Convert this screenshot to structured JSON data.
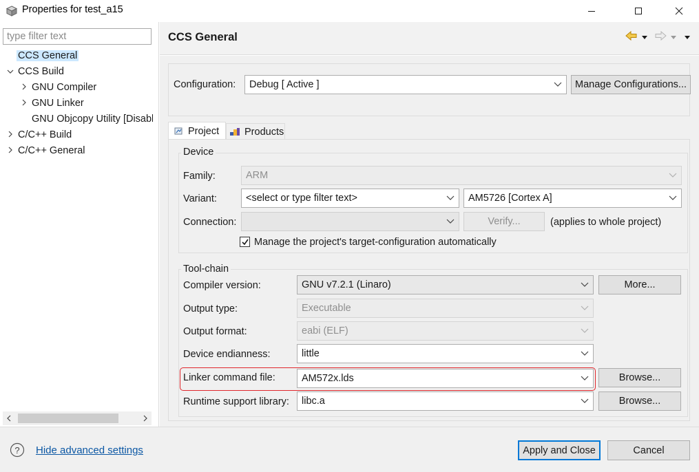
{
  "window": {
    "title": "Properties for test_a15"
  },
  "left": {
    "filter_placeholder": "type filter text",
    "tree": [
      {
        "label": "CCS General",
        "level": 0,
        "expander": "",
        "selected": true
      },
      {
        "label": "CCS Build",
        "level": 0,
        "expander": "expanded"
      },
      {
        "label": "GNU Compiler",
        "level": 1,
        "expander": "collapsed"
      },
      {
        "label": "GNU Linker",
        "level": 1,
        "expander": "collapsed"
      },
      {
        "label": "GNU Objcopy Utility  [Disabled]",
        "level": 1,
        "expander": ""
      },
      {
        "label": "C/C++ Build",
        "level": 0,
        "expander": "collapsed"
      },
      {
        "label": "C/C++ General",
        "level": 0,
        "expander": "collapsed"
      }
    ]
  },
  "page": {
    "title": "CCS General",
    "configuration": {
      "label": "Configuration:",
      "value": "Debug  [ Active ]",
      "manage_button": "Manage Configurations..."
    },
    "tabs": [
      {
        "label": "Project",
        "active": true,
        "icon": "project-icon"
      },
      {
        "label": "Products",
        "active": false,
        "icon": "products-icon"
      }
    ],
    "device": {
      "group_title": "Device",
      "family_label": "Family:",
      "family_value": "ARM",
      "variant_label": "Variant:",
      "variant_filter": "<select or type filter text>",
      "variant_value": "AM5726 [Cortex A]",
      "connection_label": "Connection:",
      "connection_value": "",
      "verify_button": "Verify...",
      "applies_note": "(applies to whole project)",
      "manage_checkbox_label": "Manage the project's target-configuration automatically",
      "manage_checked": true
    },
    "toolchain": {
      "group_title": "Tool-chain",
      "compiler_label": "Compiler version:",
      "compiler_value": "GNU v7.2.1 (Linaro)",
      "more_button": "More...",
      "output_type_label": "Output type:",
      "output_type_value": "Executable",
      "output_format_label": "Output format:",
      "output_format_value": "eabi (ELF)",
      "endianness_label": "Device endianness:",
      "endianness_value": "little",
      "linker_label": "Linker command file:",
      "linker_value": "AM572x.lds",
      "browse_button": "Browse...",
      "runtime_label": "Runtime support library:",
      "runtime_value": "libc.a",
      "browse_button_2": "Browse..."
    }
  },
  "footer": {
    "advanced_link": "Hide advanced settings",
    "apply_close": "Apply and Close",
    "cancel": "Cancel"
  },
  "colors": {
    "highlight_border": "#e0262b",
    "selection": "#cce8ff",
    "link": "#0b57a4",
    "default_button_border": "#0078d7"
  }
}
